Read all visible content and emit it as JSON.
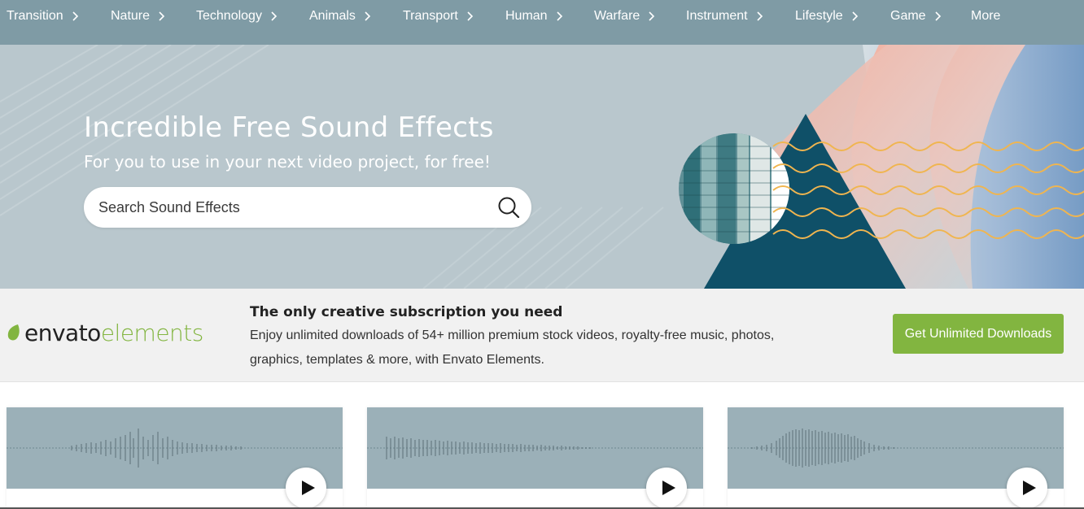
{
  "nav": {
    "items": [
      {
        "label": "Transition",
        "has_chevron": true
      },
      {
        "label": "Nature",
        "has_chevron": true
      },
      {
        "label": "Technology",
        "has_chevron": true
      },
      {
        "label": "Animals",
        "has_chevron": true
      },
      {
        "label": "Transport",
        "has_chevron": true
      },
      {
        "label": "Human",
        "has_chevron": true
      },
      {
        "label": "Warfare",
        "has_chevron": true
      },
      {
        "label": "Instrument",
        "has_chevron": true
      },
      {
        "label": "Lifestyle",
        "has_chevron": true
      },
      {
        "label": "Game",
        "has_chevron": true
      },
      {
        "label": "More",
        "has_chevron": false
      }
    ],
    "chevron_icon": "chevron-right-icon"
  },
  "hero": {
    "title": "Incredible Free Sound Effects",
    "subtitle": "For you to use in your next video project, for free!",
    "search_placeholder": "Search Sound Effects",
    "search_value": "",
    "search_icon": "search-icon"
  },
  "promo": {
    "logo_part1": "envato",
    "logo_part2": "elements",
    "title": "The only creative subscription you need",
    "text": "Enjoy unlimited downloads of 54+ million premium stock videos, royalty-free music, photos, graphics, templates & more, with Envato Elements.",
    "button_label": "Get Unlimited Downloads"
  },
  "cards": [
    {
      "play_icon": "play-icon",
      "waveform_icon": "waveform-icon"
    },
    {
      "play_icon": "play-icon",
      "waveform_icon": "waveform-icon"
    },
    {
      "play_icon": "play-icon",
      "waveform_icon": "waveform-icon"
    }
  ],
  "colors": {
    "nav_bg": "#7f9ba5",
    "hero_bg": "#b9c7cd",
    "accent_green": "#82b540",
    "card_wave_bg": "#9bb0b8",
    "promo_bg": "#f1f1f1"
  }
}
